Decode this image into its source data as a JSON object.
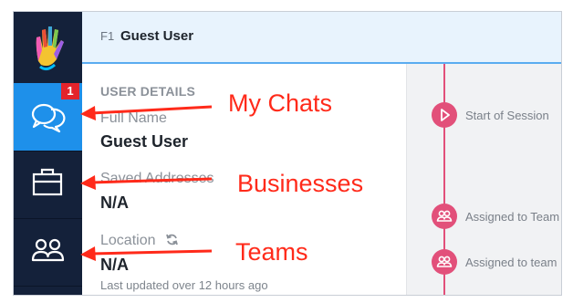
{
  "header": {
    "shortcut": "F1",
    "user_name": "Guest User"
  },
  "sidebar": {
    "logo": "hand-logo-icon",
    "items": [
      {
        "name": "chats",
        "icon": "chat-bubbles-icon",
        "badge": "1",
        "active": true
      },
      {
        "name": "businesses",
        "icon": "briefcase-icon",
        "active": false
      },
      {
        "name": "teams",
        "icon": "people-icon",
        "active": false
      }
    ]
  },
  "details": {
    "section_title": "USER DETAILS",
    "full_name_label": "Full Name",
    "full_name_value": "Guest User",
    "saved_addresses_label": "Saved Addresses",
    "saved_addresses_value": "N/A",
    "location_label": "Location",
    "location_value": "N/A",
    "location_updated": "Last updated over 12 hours ago"
  },
  "timeline": {
    "events": [
      {
        "icon": "play-icon",
        "text": "Start of Session"
      },
      {
        "icon": "team-icon",
        "text": "Assigned to Team"
      },
      {
        "icon": "team-icon",
        "text": "Assigned to team"
      }
    ]
  },
  "annotations": {
    "chats": "My Chats",
    "businesses": "Businesses",
    "teams": "Teams"
  },
  "colors": {
    "sidebar": "#14213a",
    "active": "#1e90ea",
    "accent": "#e2507a",
    "annotation": "#ff2a1a"
  }
}
